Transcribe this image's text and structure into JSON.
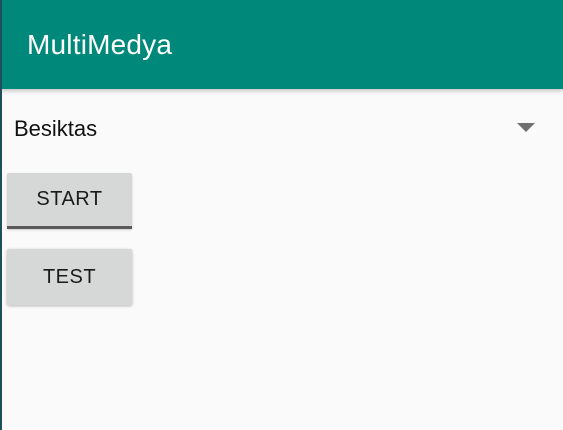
{
  "app_bar": {
    "title": "MultiMedya",
    "background_color": "#00897b"
  },
  "spinner": {
    "selected_value": "Besiktas",
    "arrow_icon": "dropdown-triangle-icon"
  },
  "buttons": {
    "start_label": "START",
    "test_label": "TEST"
  }
}
